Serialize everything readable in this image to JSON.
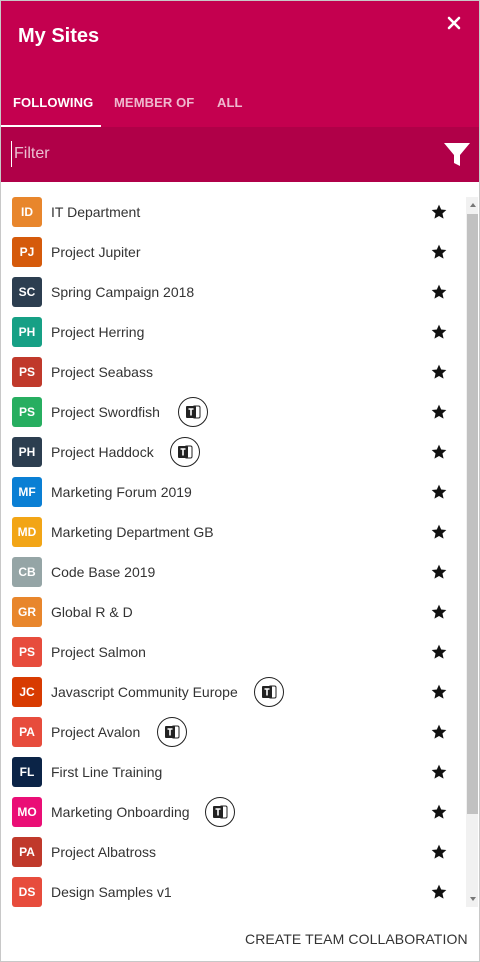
{
  "panel": {
    "title": "My Sites"
  },
  "tabs": [
    {
      "label": "FOLLOWING",
      "active": true
    },
    {
      "label": "MEMBER OF",
      "active": false
    },
    {
      "label": "ALL",
      "active": false
    }
  ],
  "filter": {
    "placeholder": "Filter",
    "value": ""
  },
  "colors": {
    "header": "#c4004f",
    "filter_bar": "#b00048"
  },
  "sites": [
    {
      "initials": "ID",
      "name": "IT Department",
      "color": "#e8862c",
      "teams": false,
      "favorite": true
    },
    {
      "initials": "PJ",
      "name": "Project Jupiter",
      "color": "#d55a0b",
      "teams": false,
      "favorite": true
    },
    {
      "initials": "SC",
      "name": "Spring Campaign 2018",
      "color": "#2c3e50",
      "teams": false,
      "favorite": true
    },
    {
      "initials": "PH",
      "name": "Project Herring",
      "color": "#16a085",
      "teams": false,
      "favorite": true
    },
    {
      "initials": "PS",
      "name": "Project Seabass",
      "color": "#c0392b",
      "teams": false,
      "favorite": true
    },
    {
      "initials": "PS",
      "name": "Project Swordfish",
      "color": "#27ae60",
      "teams": true,
      "favorite": true
    },
    {
      "initials": "PH",
      "name": "Project Haddock",
      "color": "#2c3e50",
      "teams": true,
      "favorite": true
    },
    {
      "initials": "MF",
      "name": "Marketing Forum 2019",
      "color": "#0a7fd4",
      "teams": false,
      "favorite": true
    },
    {
      "initials": "MD",
      "name": "Marketing Department GB",
      "color": "#f2a516",
      "teams": false,
      "favorite": true
    },
    {
      "initials": "CB",
      "name": "Code Base 2019",
      "color": "#95a5a6",
      "teams": false,
      "favorite": true
    },
    {
      "initials": "GR",
      "name": "Global R & D",
      "color": "#e8862c",
      "teams": false,
      "favorite": true
    },
    {
      "initials": "PS",
      "name": "Project Salmon",
      "color": "#e74c3c",
      "teams": false,
      "favorite": true
    },
    {
      "initials": "JC",
      "name": "Javascript Community Europe",
      "color": "#d83b01",
      "teams": true,
      "favorite": true
    },
    {
      "initials": "PA",
      "name": "Project Avalon",
      "color": "#e74c3c",
      "teams": true,
      "favorite": true
    },
    {
      "initials": "FL",
      "name": "First Line Training",
      "color": "#0b2447",
      "teams": false,
      "favorite": true
    },
    {
      "initials": "MO",
      "name": "Marketing Onboarding",
      "color": "#ea0e76",
      "teams": true,
      "favorite": true
    },
    {
      "initials": "PA",
      "name": "Project Albatross",
      "color": "#c0392b",
      "teams": false,
      "favorite": true
    },
    {
      "initials": "DS",
      "name": "Design Samples v1",
      "color": "#e74c3c",
      "teams": false,
      "favorite": true
    }
  ],
  "footer": {
    "create_label": "CREATE TEAM COLLABORATION"
  },
  "icons": {
    "close": "close-icon",
    "filter": "funnel-icon",
    "teams": "teams-icon",
    "favorite": "star-icon"
  }
}
